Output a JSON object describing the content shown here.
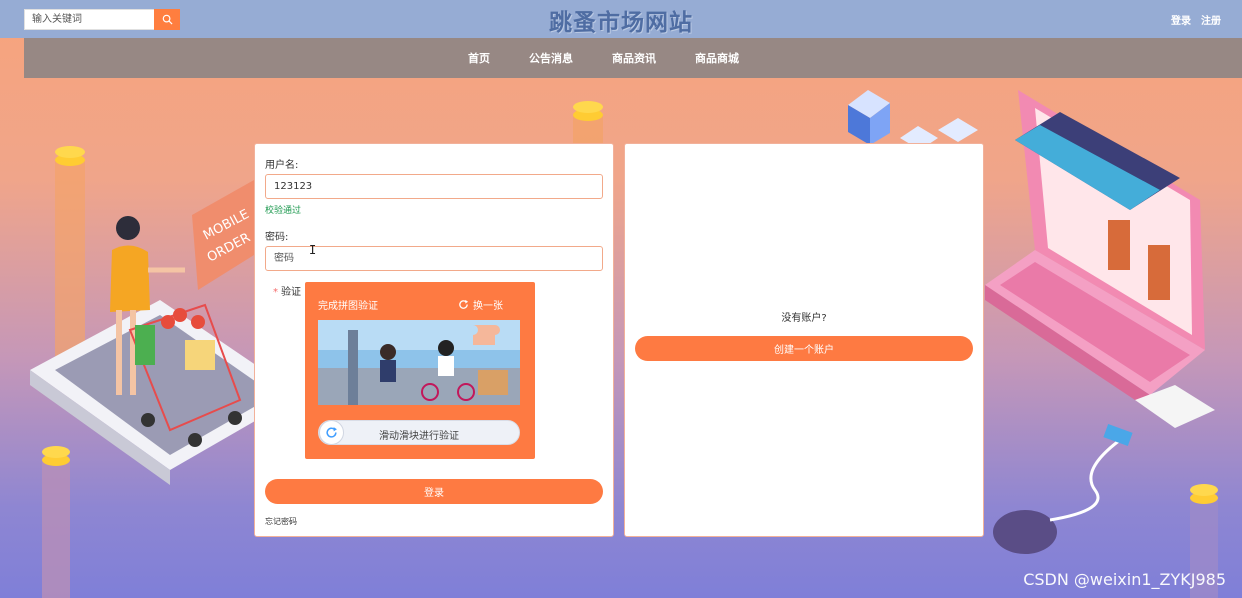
{
  "header": {
    "search_placeholder": "输入关键词",
    "site_title": "跳蚤市场网站",
    "login_link": "登录",
    "register_link": "注册"
  },
  "nav": {
    "items": [
      "首页",
      "公告消息",
      "商品资讯",
      "商品商城"
    ]
  },
  "login_form": {
    "username_label": "用户名:",
    "username_value": "123123",
    "username_valid_msg": "校验通过",
    "password_label": "密码:",
    "password_placeholder": "密码",
    "captcha_label": "验证",
    "captcha_title": "完成拼图验证",
    "captcha_refresh": "换一张",
    "slider_text": "滑动滑块进行验证",
    "login_button": "登录",
    "forgot_password": "忘记密码"
  },
  "register_panel": {
    "no_account_text": "没有账户?",
    "create_account_button": "创建一个账户"
  },
  "background_art": {
    "sign_text_1": "MOBILE",
    "sign_text_2": "ORDER"
  },
  "watermark": "CSDN @weixin1_ZYKJ985",
  "colors": {
    "accent": "#fe7a42",
    "topbar": "#96acd4",
    "navbar": "#978884",
    "title": "#4f6da3",
    "valid": "#1f9a51"
  }
}
